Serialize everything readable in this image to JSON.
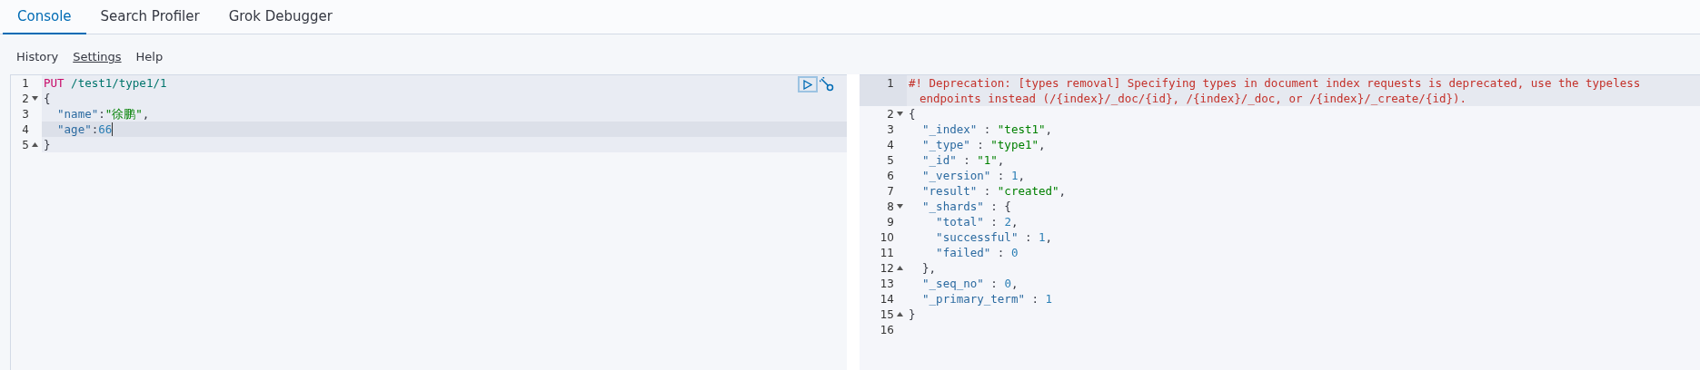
{
  "tabs": [
    {
      "label": "Console",
      "selected": true
    },
    {
      "label": "Search Profiler",
      "selected": false
    },
    {
      "label": "Grok Debugger",
      "selected": false
    }
  ],
  "menu": [
    {
      "label": "History",
      "selected": false
    },
    {
      "label": "Settings",
      "selected": true
    },
    {
      "label": "Help",
      "selected": false
    }
  ],
  "request_editor": {
    "lines": [
      {
        "number": "1",
        "fold_start": false,
        "fold_end": false,
        "active": false,
        "cursor": false,
        "tokens": [
          {
            "kind": "method",
            "text": "PUT"
          },
          {
            "kind": "path",
            "text": " /test1/type1/1"
          }
        ]
      },
      {
        "number": "2",
        "fold_start": true,
        "fold_end": false,
        "active": false,
        "cursor": false,
        "tokens": [
          {
            "kind": "plain",
            "text": "{"
          }
        ]
      },
      {
        "number": "3",
        "fold_start": false,
        "fold_end": false,
        "active": false,
        "cursor": false,
        "tokens": [
          {
            "kind": "key",
            "text": "  \"name\""
          },
          {
            "kind": "plain",
            "text": ":"
          },
          {
            "kind": "string",
            "text": "\"徐鹏\""
          },
          {
            "kind": "plain",
            "text": ","
          }
        ]
      },
      {
        "number": "4",
        "fold_start": false,
        "fold_end": false,
        "active": true,
        "cursor": true,
        "tokens": [
          {
            "kind": "key",
            "text": "  \"age\""
          },
          {
            "kind": "plain",
            "text": ":"
          },
          {
            "kind": "number",
            "text": "66"
          }
        ]
      },
      {
        "number": "5",
        "fold_start": false,
        "fold_end": true,
        "active": false,
        "cursor": false,
        "tokens": [
          {
            "kind": "plain",
            "text": "}"
          }
        ]
      }
    ]
  },
  "response_editor": {
    "lines": [
      {
        "number": "1",
        "fold_start": false,
        "fold_end": false,
        "active": true,
        "tokens": [
          {
            "kind": "comment",
            "text": "#! Deprecation: [types removal] Specifying types in document index requests is deprecated, use the typeless"
          }
        ],
        "continuation": [
          {
            "kind": "comment",
            "text": "endpoints instead (/{index}/_doc/{id}, /{index}/_doc, or /{index}/_create/{id})."
          }
        ]
      },
      {
        "number": "2",
        "fold_start": true,
        "fold_end": false,
        "active": false,
        "tokens": [
          {
            "kind": "plain",
            "text": "{"
          }
        ]
      },
      {
        "number": "3",
        "fold_start": false,
        "fold_end": false,
        "active": false,
        "tokens": [
          {
            "kind": "key",
            "text": "  \"_index\""
          },
          {
            "kind": "plain",
            "text": " : "
          },
          {
            "kind": "string",
            "text": "\"test1\""
          },
          {
            "kind": "plain",
            "text": ","
          }
        ]
      },
      {
        "number": "4",
        "fold_start": false,
        "fold_end": false,
        "active": false,
        "tokens": [
          {
            "kind": "key",
            "text": "  \"_type\""
          },
          {
            "kind": "plain",
            "text": " : "
          },
          {
            "kind": "string",
            "text": "\"type1\""
          },
          {
            "kind": "plain",
            "text": ","
          }
        ]
      },
      {
        "number": "5",
        "fold_start": false,
        "fold_end": false,
        "active": false,
        "tokens": [
          {
            "kind": "key",
            "text": "  \"_id\""
          },
          {
            "kind": "plain",
            "text": " : "
          },
          {
            "kind": "string",
            "text": "\"1\""
          },
          {
            "kind": "plain",
            "text": ","
          }
        ]
      },
      {
        "number": "6",
        "fold_start": false,
        "fold_end": false,
        "active": false,
        "tokens": [
          {
            "kind": "key",
            "text": "  \"_version\""
          },
          {
            "kind": "plain",
            "text": " : "
          },
          {
            "kind": "number",
            "text": "1"
          },
          {
            "kind": "plain",
            "text": ","
          }
        ]
      },
      {
        "number": "7",
        "fold_start": false,
        "fold_end": false,
        "active": false,
        "tokens": [
          {
            "kind": "key",
            "text": "  \"result\""
          },
          {
            "kind": "plain",
            "text": " : "
          },
          {
            "kind": "string",
            "text": "\"created\""
          },
          {
            "kind": "plain",
            "text": ","
          }
        ]
      },
      {
        "number": "8",
        "fold_start": true,
        "fold_end": false,
        "active": false,
        "tokens": [
          {
            "kind": "key",
            "text": "  \"_shards\""
          },
          {
            "kind": "plain",
            "text": " : {"
          }
        ]
      },
      {
        "number": "9",
        "fold_start": false,
        "fold_end": false,
        "active": false,
        "tokens": [
          {
            "kind": "key",
            "text": "    \"total\""
          },
          {
            "kind": "plain",
            "text": " : "
          },
          {
            "kind": "number",
            "text": "2"
          },
          {
            "kind": "plain",
            "text": ","
          }
        ]
      },
      {
        "number": "10",
        "fold_start": false,
        "fold_end": false,
        "active": false,
        "tokens": [
          {
            "kind": "key",
            "text": "    \"successful\""
          },
          {
            "kind": "plain",
            "text": " : "
          },
          {
            "kind": "number",
            "text": "1"
          },
          {
            "kind": "plain",
            "text": ","
          }
        ]
      },
      {
        "number": "11",
        "fold_start": false,
        "fold_end": false,
        "active": false,
        "tokens": [
          {
            "kind": "key",
            "text": "    \"failed\""
          },
          {
            "kind": "plain",
            "text": " : "
          },
          {
            "kind": "number",
            "text": "0"
          }
        ]
      },
      {
        "number": "12",
        "fold_start": false,
        "fold_end": true,
        "active": false,
        "tokens": [
          {
            "kind": "plain",
            "text": "  },"
          }
        ]
      },
      {
        "number": "13",
        "fold_start": false,
        "fold_end": false,
        "active": false,
        "tokens": [
          {
            "kind": "key",
            "text": "  \"_seq_no\""
          },
          {
            "kind": "plain",
            "text": " : "
          },
          {
            "kind": "number",
            "text": "0"
          },
          {
            "kind": "plain",
            "text": ","
          }
        ]
      },
      {
        "number": "14",
        "fold_start": false,
        "fold_end": false,
        "active": false,
        "tokens": [
          {
            "kind": "key",
            "text": "  \"_primary_term\""
          },
          {
            "kind": "plain",
            "text": " : "
          },
          {
            "kind": "number",
            "text": "1"
          }
        ]
      },
      {
        "number": "15",
        "fold_start": false,
        "fold_end": true,
        "active": false,
        "tokens": [
          {
            "kind": "plain",
            "text": "}"
          }
        ]
      },
      {
        "number": "16",
        "fold_start": false,
        "fold_end": false,
        "active": false
      }
    ]
  }
}
